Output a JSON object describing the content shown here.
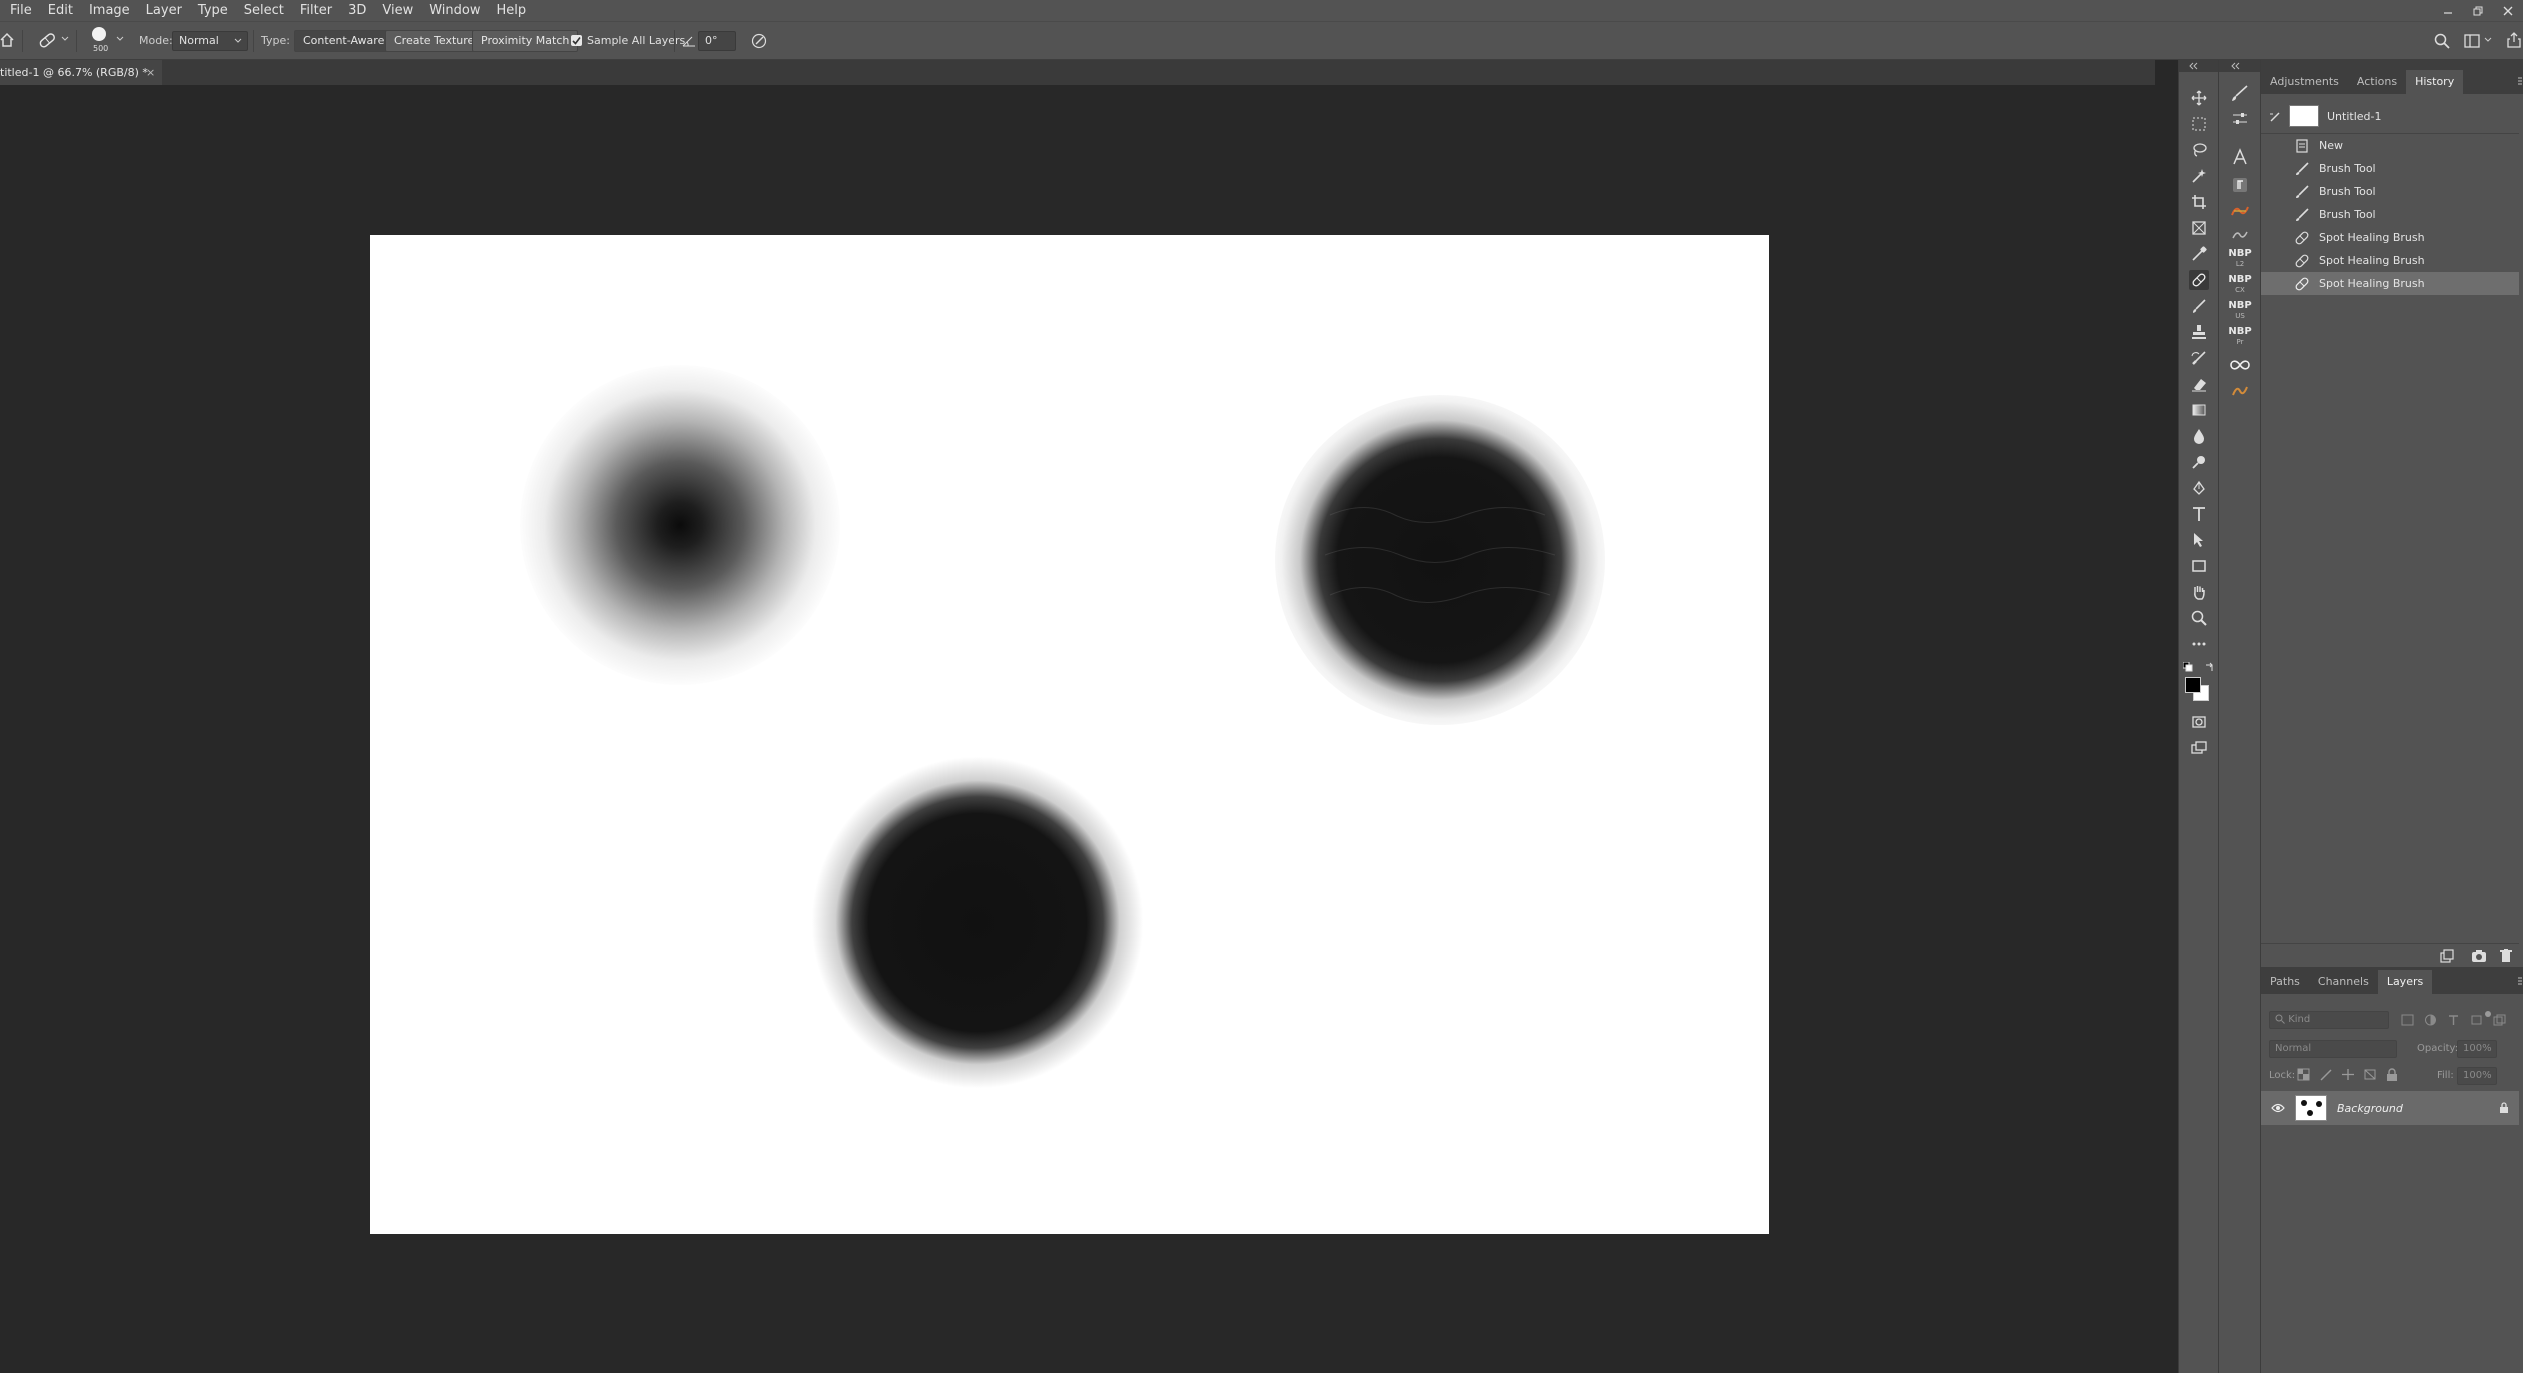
{
  "menu": [
    "File",
    "Edit",
    "Image",
    "Layer",
    "Type",
    "Select",
    "Filter",
    "3D",
    "View",
    "Window",
    "Help"
  ],
  "options_bar": {
    "brush_size": "500",
    "mode_label": "Mode:",
    "mode_value": "Normal",
    "type_label": "Type:",
    "type_options": [
      "Content-Aware",
      "Create Texture",
      "Proximity Match"
    ],
    "sample_all_layers": "Sample All Layers",
    "angle_value": "0°"
  },
  "document": {
    "tab_title": "titled-1 @ 66.7% (RGB/8) *",
    "close_glyph": "×"
  },
  "panels": {
    "top_tabs": [
      "Adjustments",
      "Actions",
      "History"
    ],
    "active_top_tab": "History",
    "history": {
      "snapshot": "Untitled-1",
      "states": [
        "New",
        "Brush Tool",
        "Brush Tool",
        "Brush Tool",
        "Spot Healing Brush",
        "Spot Healing Brush",
        "Spot Healing Brush"
      ],
      "selected_index": 6
    },
    "bottom_tabs": [
      "Paths",
      "Channels",
      "Layers"
    ],
    "active_bottom_tab": "Layers",
    "layers": {
      "filter_placeholder": "Kind",
      "blend_mode": "Normal",
      "opacity_label": "Opacity:",
      "opacity_value": "100%",
      "lock_label": "Lock:",
      "fill_label": "Fill:",
      "fill_value": "100%",
      "items": [
        {
          "name": "Background",
          "locked": true,
          "visible": true
        }
      ]
    }
  },
  "dock": {
    "nbp_labels": [
      {
        "top": "NBP",
        "sub": "L2"
      },
      {
        "top": "NBP",
        "sub": "CX"
      },
      {
        "top": "NBP",
        "sub": "US"
      },
      {
        "top": "NBP",
        "sub": "Pr"
      }
    ]
  },
  "colors": {
    "foreground": "#000000",
    "background": "#ffffff",
    "panel_bg": "#535353",
    "workspace_bg": "#282828"
  }
}
